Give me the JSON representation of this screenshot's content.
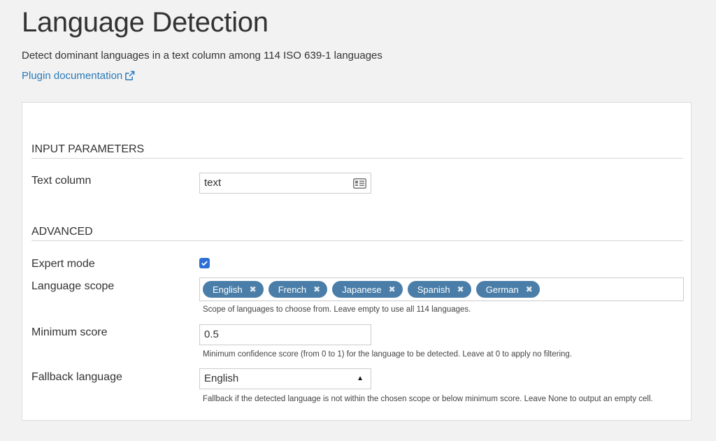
{
  "header": {
    "title": "Language Detection",
    "description": "Detect dominant languages in a text column among 114 ISO 639-1 languages",
    "doc_link": "Plugin documentation"
  },
  "sections": {
    "input": {
      "title": "INPUT PARAMETERS",
      "text_column": {
        "label": "Text column",
        "value": "text",
        "icon": "column-icon"
      }
    },
    "advanced": {
      "title": "ADVANCED",
      "expert_mode": {
        "label": "Expert mode",
        "checked": true
      },
      "language_scope": {
        "label": "Language scope",
        "tags": [
          "English",
          "French",
          "Japanese",
          "Spanish",
          "German"
        ],
        "remove_glyph": "✖",
        "help": "Scope of languages to choose from. Leave empty to use all 114 languages."
      },
      "minimum_score": {
        "label": "Minimum score",
        "value": "0.5",
        "help": "Minimum confidence score (from 0 to 1) for the language to be detected. Leave at 0 to apply no filtering."
      },
      "fallback_language": {
        "label": "Fallback language",
        "value": "English",
        "help": "Fallback if the detected language is not within the chosen scope or below minimum score. Leave None to output an empty cell."
      }
    }
  },
  "colors": {
    "accent": "#2a7ab8",
    "tag": "#4a7ea8",
    "checkbox": "#2d6fd6"
  }
}
